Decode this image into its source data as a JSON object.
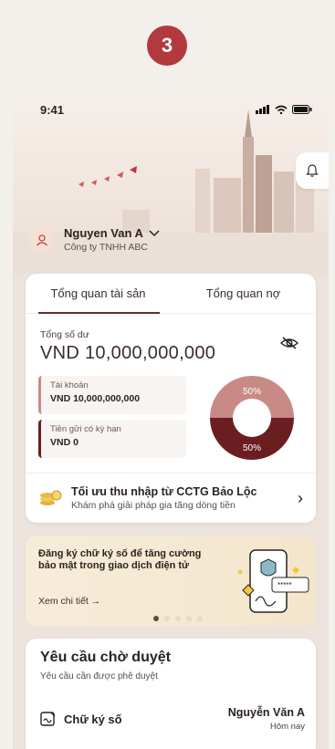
{
  "step_number": "3",
  "status_bar": {
    "time": "9:41"
  },
  "user": {
    "name": "Nguyen Van A",
    "company": "Công ty TNHH ABC"
  },
  "tabs": [
    {
      "label": "Tổng quan tài sản",
      "active": true
    },
    {
      "label": "Tổng quan nợ",
      "active": false
    }
  ],
  "balance": {
    "label": "Tổng số dư",
    "value": "VND 10,000,000,000"
  },
  "accounts": [
    {
      "label": "Tài khoản",
      "value": "VND 10,000,000,000"
    },
    {
      "label": "Tiền gửi có kỳ hạn",
      "value": "VND 0"
    }
  ],
  "donut": {
    "top_pct": "50%",
    "bottom_pct": "50%",
    "top_fraction": 0.5,
    "bottom_fraction": 0.5,
    "top_color": "#c98a86",
    "bottom_color": "#6b1e20"
  },
  "promo": {
    "title": "Tối ưu thu nhập từ CCTG Bảo Lộc",
    "subtitle": "Khám phá giải pháp gia tăng dòng tiền"
  },
  "banner": {
    "text": "Đăng ký chữ ký số để tăng cường bảo mật trong giao dịch điện tử",
    "link": "Xem chi tiết →",
    "slides": 5,
    "active_slide": 1
  },
  "pending": {
    "title": "Yêu cầu chờ duyệt",
    "subtitle": "Yêu cầu cần được phê duyệt",
    "item": {
      "label": "Chữ ký số",
      "name": "Nguyễn Văn A",
      "time": "Hôm nay"
    }
  },
  "colors": {
    "brand_red": "#b2393e",
    "dark_maroon": "#6b1e20",
    "rose": "#c98a86"
  }
}
